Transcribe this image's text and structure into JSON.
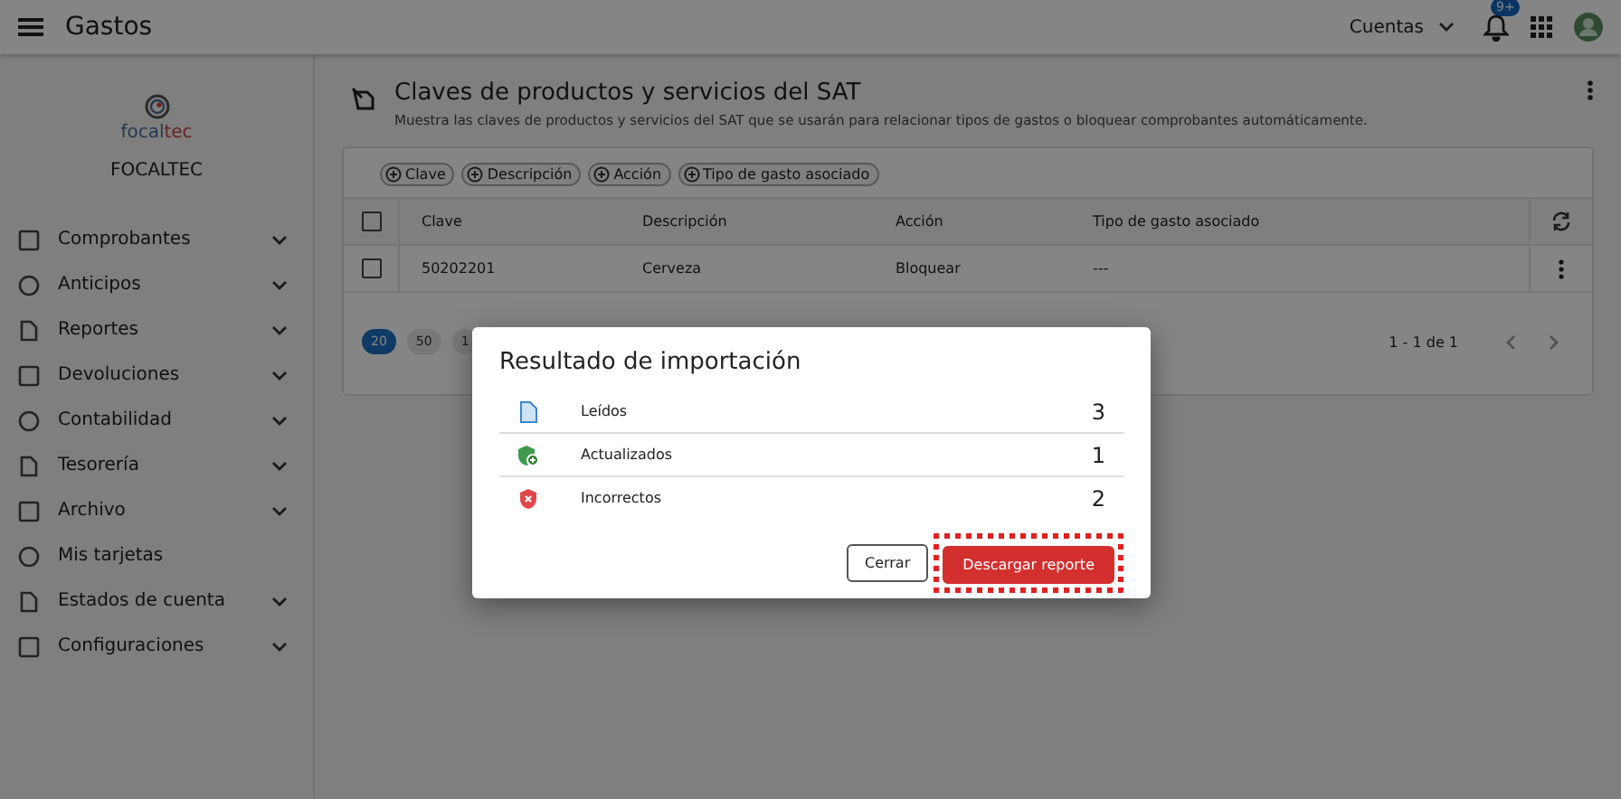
{
  "app_bar": {
    "title": "Gastos",
    "account_menu": "Cuentas",
    "notification_badge": "9+"
  },
  "sidebar": {
    "logo_text_a": "focal",
    "logo_text_b": "tec",
    "company": "FOCALTEC",
    "items": [
      {
        "label": "Comprobantes",
        "expandable": true
      },
      {
        "label": "Anticipos",
        "expandable": true
      },
      {
        "label": "Reportes",
        "expandable": true
      },
      {
        "label": "Devoluciones",
        "expandable": true
      },
      {
        "label": "Contabilidad",
        "expandable": true
      },
      {
        "label": "Tesorería",
        "expandable": true
      },
      {
        "label": "Archivo",
        "expandable": true
      },
      {
        "label": "Mis tarjetas",
        "expandable": false
      },
      {
        "label": "Estados de cuenta",
        "expandable": true
      },
      {
        "label": "Configuraciones",
        "expandable": true
      }
    ]
  },
  "page": {
    "title": "Claves de productos y servicios del SAT",
    "subtitle": "Muestra las claves de productos y servicios del SAT que se usarán para relacionar tipos de gastos o bloquear comprobantes automáticamente."
  },
  "filters": [
    "Clave",
    "Descripción",
    "Acción",
    "Tipo de gasto asociado"
  ],
  "table": {
    "select_all_checked": false,
    "columns": [
      "Clave",
      "Descripción",
      "Acción",
      "Tipo de gasto asociado"
    ],
    "rows": [
      {
        "checked": false,
        "cells": [
          "50202201",
          "Cerveza",
          "Bloquear",
          "---"
        ]
      }
    ]
  },
  "pagination": {
    "page_sizes": [
      {
        "label": "20",
        "selected": true
      },
      {
        "label": "50",
        "selected": false
      },
      {
        "label": "1",
        "selected": false
      }
    ],
    "range": "1 - 1 de 1"
  },
  "dialog": {
    "title": "Resultado de importación",
    "rows": [
      {
        "kind": "read",
        "label": "Leídos",
        "count": "3"
      },
      {
        "kind": "updated",
        "label": "Actualizados",
        "count": "1"
      },
      {
        "kind": "error",
        "label": "Incorrectos",
        "count": "2"
      }
    ],
    "buttons": [
      {
        "label": "Cerrar",
        "kind": "secondary",
        "highlighted": false
      },
      {
        "label": "Descargar reporte",
        "kind": "primary",
        "highlighted": true
      }
    ]
  }
}
